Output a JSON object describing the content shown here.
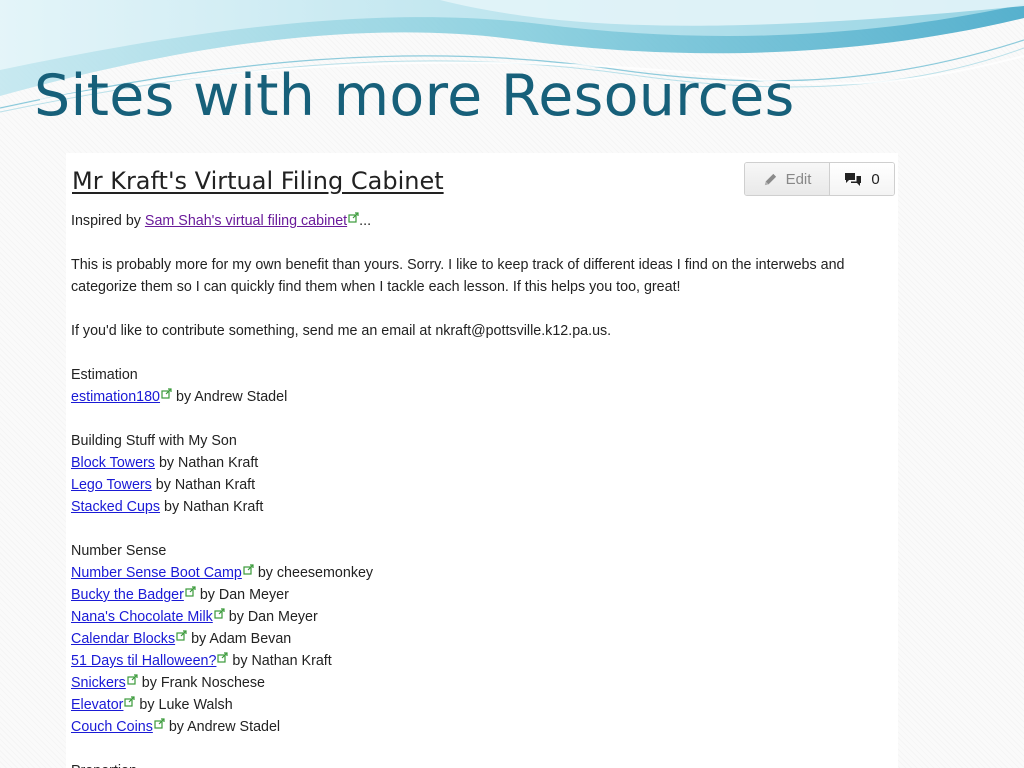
{
  "slide": {
    "title": "Sites with more Resources",
    "title_color": "#17607a"
  },
  "page": {
    "heading": "Mr Kraft's Virtual Filing Cabinet",
    "edit_label": "Edit",
    "comment_count": "0",
    "inspired_prefix": "Inspired by",
    "inspired_link": "Sam Shah's virtual filing cabinet",
    "inspired_suffix": "...",
    "intro": "This is probably more for my own benefit than yours. Sorry. I like to keep track of different ideas I find on the interwebs and categorize them so I can quickly find them when I tackle each lesson. If this helps you too, great!",
    "contribute": "If you'd like to contribute something, send me an email at nkraft@pottsville.k12.pa.us.",
    "partial_next_heading": "Proportion"
  },
  "sections": [
    {
      "heading": "Estimation",
      "items": [
        {
          "link": "estimation180",
          "external": true,
          "by": " by Andrew Stadel"
        }
      ]
    },
    {
      "heading": "Building Stuff with My Son",
      "items": [
        {
          "link": "Block Towers",
          "external": false,
          "by": " by Nathan Kraft"
        },
        {
          "link": "Lego Towers",
          "external": false,
          "by": " by Nathan Kraft"
        },
        {
          "link": "Stacked Cups",
          "external": false,
          "by": " by Nathan Kraft"
        }
      ]
    },
    {
      "heading": "Number Sense",
      "items": [
        {
          "link": "Number Sense Boot Camp",
          "external": true,
          "by": " by cheesemonkey"
        },
        {
          "link": "Bucky the Badger",
          "external": true,
          "by": " by Dan Meyer"
        },
        {
          "link": "Nana's Chocolate Milk",
          "external": true,
          "by": " by Dan Meyer"
        },
        {
          "link": "Calendar Blocks",
          "external": true,
          "by": " by Adam Bevan"
        },
        {
          "link": "51 Days til Halloween?",
          "external": true,
          "by": " by Nathan Kraft"
        },
        {
          "link": "Snickers",
          "external": true,
          "by": " by Frank Noschese"
        },
        {
          "link": "Elevator",
          "external": true,
          "by": " by Luke Walsh"
        },
        {
          "link": "Couch Coins",
          "external": true,
          "by": " by Andrew Stadel"
        }
      ]
    }
  ],
  "icons": {
    "edit": "pencil-icon",
    "comments": "comments-icon",
    "external_link": "external-link-icon"
  },
  "colors": {
    "link": "#1a1ad6",
    "visited_link": "#6a1b9a",
    "external_icon": "#3a9a3a"
  }
}
